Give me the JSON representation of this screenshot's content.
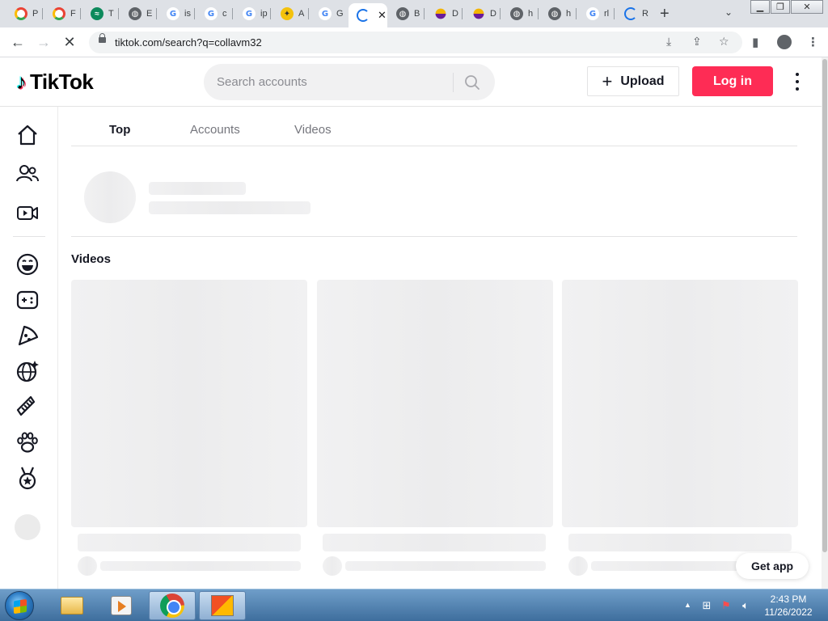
{
  "browser": {
    "tabs": [
      {
        "label": "P",
        "favicon": "maps-icon"
      },
      {
        "label": "F",
        "favicon": "maps-icon"
      },
      {
        "label": "T",
        "favicon": "green-app-icon"
      },
      {
        "label": "E",
        "favicon": "globe-icon"
      },
      {
        "label": "is",
        "favicon": "google-icon"
      },
      {
        "label": "c",
        "favicon": "google-icon"
      },
      {
        "label": "ip",
        "favicon": "google-icon"
      },
      {
        "label": "A",
        "favicon": "bee-icon"
      },
      {
        "label": "G",
        "favicon": "google-icon"
      },
      {
        "label": "",
        "favicon": "loading-spinner-icon",
        "active": true
      },
      {
        "label": "B",
        "favicon": "globe-icon"
      },
      {
        "label": "D",
        "favicon": "diamond-icon"
      },
      {
        "label": "D",
        "favicon": "diamond-icon"
      },
      {
        "label": "h",
        "favicon": "globe-icon"
      },
      {
        "label": "h",
        "favicon": "globe-icon"
      },
      {
        "label": "rl",
        "favicon": "google-icon"
      },
      {
        "label": "R",
        "favicon": "loading-spinner-icon"
      }
    ],
    "url": "tiktok.com/search?q=collavm32"
  },
  "header": {
    "logo_text": "TikTok",
    "search_placeholder": "Search accounts",
    "upload_label": "Upload",
    "login_label": "Log in"
  },
  "leftnav": {
    "items": [
      "home-icon",
      "following-icon",
      "live-icon",
      "comedy-icon",
      "gaming-icon",
      "food-icon",
      "dance-icon",
      "beauty-icon",
      "animals-icon",
      "sports-icon"
    ]
  },
  "main": {
    "tabs": [
      {
        "label": "Top",
        "active": true
      },
      {
        "label": "Accounts",
        "active": false
      },
      {
        "label": "Videos",
        "active": false
      }
    ],
    "videos_heading": "Videos",
    "get_app_label": "Get app"
  },
  "taskbar": {
    "time": "2:43 PM",
    "date": "11/26/2022"
  },
  "colors": {
    "brand_red": "#fe2c55",
    "brand_cyan": "#25f4ee",
    "skeleton": "#f1f1f2"
  }
}
